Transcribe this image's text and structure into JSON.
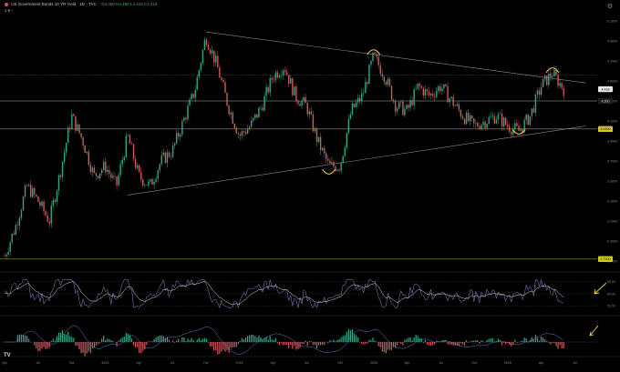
{
  "header": {
    "symbol_line": "US Government Bonds 10 YR Yield · 1D · TVC",
    "ohlc": "O4.450 H4.460 L4.412 C4.418",
    "indicator_row": "1 ▾ ‹"
  },
  "icons": {
    "settings": "gear-icon",
    "alert_dot": "red-dot-icon",
    "tv_logo": "tradingview-logo-icon"
  },
  "colors": {
    "background": "#000000",
    "up": "#2fa889",
    "down": "#d05a5a",
    "annotation": "#f2d14a",
    "trendline": "#8a8a8a",
    "hline": "#e0e0e0",
    "yellow_hline": "#cfc13a",
    "osc_fast": "#9a8ad8",
    "osc_slow": "#e6e6e6"
  },
  "chart_data": {
    "type": "candlestick",
    "title": "US Government Bonds 10 YR Yield",
    "x_ticks": [
      "Apr",
      "Jul",
      "Oct",
      "2023",
      "Apr",
      "Jul",
      "Oct",
      "2024",
      "Apr",
      "Jul",
      "Oct",
      "2025",
      "Apr",
      "Jul",
      "Oct",
      "2026",
      "Apr",
      "Jul"
    ],
    "y_ticks": [
      "5.1000",
      "4.9000",
      "4.7000",
      "4.5000",
      "4.3000",
      "4.1000",
      "3.9000",
      "3.7000",
      "3.5000",
      "3.3000",
      "3.1000",
      "2.9000",
      "2.7000"
    ],
    "ylim": [
      2.6,
      5.2
    ],
    "price_labels": [
      {
        "value": 4.418,
        "text": "4.418",
        "style": "current"
      },
      {
        "value": 4.3,
        "text": "4.300",
        "style": "dark"
      },
      {
        "value": 4.02,
        "text": "4.0200",
        "style": "yellow"
      },
      {
        "value": 2.72,
        "text": "2.7200",
        "style": "yellow"
      }
    ],
    "horizontal_levels": [
      4.3,
      4.56,
      4.02,
      2.72
    ],
    "trendlines": [
      {
        "from": [
          "2023-10",
          4.99
        ],
        "to": [
          "2026-08",
          4.48
        ]
      },
      {
        "from": [
          "2023-03",
          3.36
        ],
        "to": [
          "2026-08",
          4.05
        ]
      }
    ],
    "close_path": [
      [
        "2022-04",
        2.75
      ],
      [
        "2022-05",
        3.05
      ],
      [
        "2022-06",
        3.45
      ],
      [
        "2022-07",
        3.3
      ],
      [
        "2022-08",
        3.1
      ],
      [
        "2022-09",
        3.6
      ],
      [
        "2022-10",
        4.15
      ],
      [
        "2022-11",
        3.9
      ],
      [
        "2022-12",
        3.55
      ],
      [
        "2023-01",
        3.65
      ],
      [
        "2023-02",
        3.45
      ],
      [
        "2023-03",
        3.95
      ],
      [
        "2023-04",
        3.55
      ],
      [
        "2023-05",
        3.45
      ],
      [
        "2023-06",
        3.7
      ],
      [
        "2023-07",
        3.8
      ],
      [
        "2023-08",
        4.1
      ],
      [
        "2023-09",
        4.4
      ],
      [
        "2023-10",
        4.95
      ],
      [
        "2023-11",
        4.65
      ],
      [
        "2023-12",
        4.25
      ],
      [
        "2024-01",
        3.95
      ],
      [
        "2024-02",
        4.05
      ],
      [
        "2024-03",
        4.25
      ],
      [
        "2024-04",
        4.55
      ],
      [
        "2024-05",
        4.65
      ],
      [
        "2024-06",
        4.35
      ],
      [
        "2024-07",
        4.25
      ],
      [
        "2024-08",
        3.9
      ],
      [
        "2024-09",
        3.65
      ],
      [
        "2024-10",
        3.65
      ],
      [
        "2024-11",
        4.2
      ],
      [
        "2024-12",
        4.35
      ],
      [
        "2025-01",
        4.75
      ],
      [
        "2025-02",
        4.55
      ],
      [
        "2025-03",
        4.25
      ],
      [
        "2025-04",
        4.2
      ],
      [
        "2025-05",
        4.45
      ],
      [
        "2025-06",
        4.35
      ],
      [
        "2025-07",
        4.45
      ],
      [
        "2025-08",
        4.3
      ],
      [
        "2025-09",
        4.15
      ],
      [
        "2025-10",
        4.05
      ],
      [
        "2025-11",
        4.1
      ],
      [
        "2025-12",
        4.15
      ],
      [
        "2026-01",
        4.05
      ],
      [
        "2026-02",
        4.0
      ],
      [
        "2026-03",
        4.15
      ],
      [
        "2026-04",
        4.45
      ],
      [
        "2026-05",
        4.58
      ],
      [
        "2026-06",
        4.42
      ]
    ],
    "annotations": [
      {
        "type": "arc-top",
        "at": [
          "2025-01",
          4.8
        ]
      },
      {
        "type": "arc-bottom",
        "at": [
          "2024-09",
          3.58
        ]
      },
      {
        "type": "arc-bottom",
        "at": [
          "2026-02",
          3.98
        ]
      },
      {
        "type": "arc-top",
        "at": [
          "2026-05",
          4.62
        ]
      }
    ],
    "oscillator": {
      "type": "line",
      "ylim": [
        0,
        100
      ],
      "y_ticks": [
        "80.00",
        "50.00",
        "20.00"
      ],
      "annotation_arrow": "down-left"
    },
    "histogram": {
      "type": "bar",
      "annotation_arrow": "down-left"
    }
  }
}
